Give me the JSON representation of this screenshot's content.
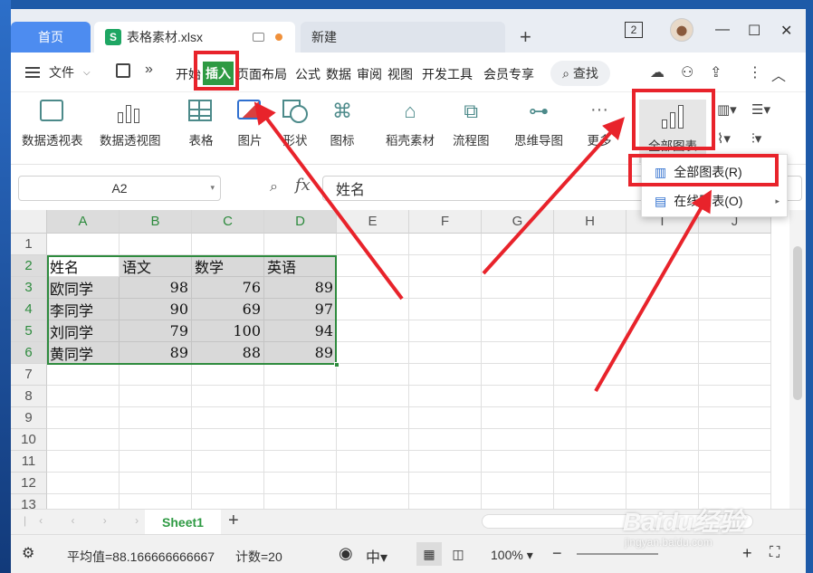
{
  "titlebar": {
    "home_tab": "首页",
    "file_tab": "表格素材.xlsx",
    "file_icon_letter": "S",
    "new_tab": "新建",
    "count_badge": "2"
  },
  "menu": {
    "file": "文件",
    "items": [
      "开始",
      "插入",
      "页面布局",
      "公式",
      "数据",
      "审阅",
      "视图",
      "开发工具",
      "会员专享"
    ],
    "search": "查找"
  },
  "ribbon": {
    "pivot_table": "数据透视表",
    "pivot_chart": "数据透视图",
    "table": "表格",
    "picture": "图片",
    "shape": "形状",
    "icon": "图标",
    "material": "稻壳素材",
    "flowchart": "流程图",
    "mindmap": "思维导图",
    "more": "更多",
    "all_charts": "全部图表"
  },
  "dropdown": {
    "items": [
      {
        "label": "全部图表(R)"
      },
      {
        "label": "在线图表(O)"
      }
    ]
  },
  "formula_bar": {
    "cell_ref": "A2",
    "fx": "fx",
    "value": "姓名"
  },
  "sheet": {
    "columns": [
      "A",
      "B",
      "C",
      "D",
      "E",
      "F",
      "G",
      "H",
      "I",
      "J"
    ],
    "rows": [
      "1",
      "2",
      "3",
      "4",
      "5",
      "6",
      "7",
      "8",
      "9",
      "10",
      "11",
      "12",
      "13"
    ],
    "table": [
      [
        "姓名",
        "语文",
        "数学",
        "英语"
      ],
      [
        "欧同学",
        "98",
        "76",
        "89"
      ],
      [
        "李同学",
        "90",
        "69",
        "97"
      ],
      [
        "刘同学",
        "79",
        "100",
        "94"
      ],
      [
        "黄同学",
        "89",
        "88",
        "89"
      ]
    ]
  },
  "sheet_tabs": {
    "active": "Sheet1"
  },
  "status": {
    "average": "平均值=88.166666666667",
    "count": "计数=20",
    "zoom": "100%"
  },
  "watermark": {
    "main": "Baidu经验",
    "sub": "jingyan.baidu.com"
  },
  "colors": {
    "accent_green": "#2e9a43",
    "annotation_red": "#e8232b",
    "home_tab_blue": "#4d8cf0"
  }
}
